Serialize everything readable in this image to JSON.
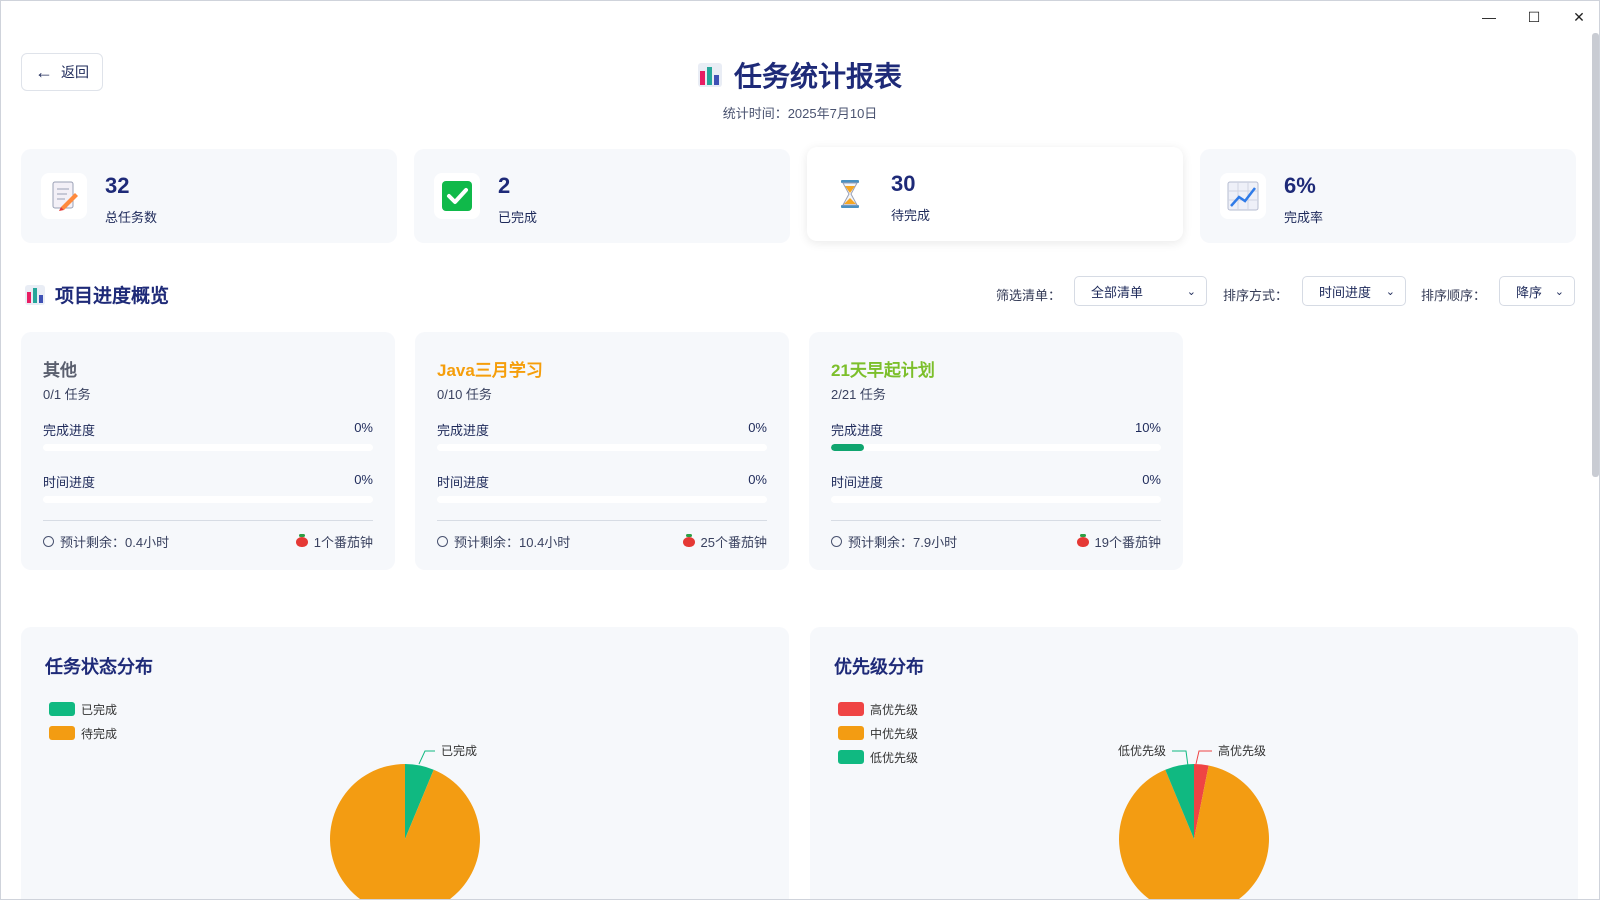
{
  "back_label": "返回",
  "header": {
    "title": "任务统计报表",
    "subtitle": "统计时间：2025年7月10日"
  },
  "stats": [
    {
      "value": "32",
      "label": "总任务数",
      "icon": "memo-icon"
    },
    {
      "value": "2",
      "label": "已完成",
      "icon": "check-icon"
    },
    {
      "value": "30",
      "label": "待完成",
      "icon": "hourglass-icon"
    },
    {
      "value": "6%",
      "label": "完成率",
      "icon": "trend-chart-icon"
    }
  ],
  "overview": {
    "title": "项目进度概览",
    "filter_label": "筛选清单：",
    "filter_value": "全部清单",
    "sort_label": "排序方式：",
    "sort_value": "时间进度",
    "order_label": "排序顺序：",
    "order_value": "降序"
  },
  "projects": [
    {
      "name": "其他",
      "color": "#5a5f6e",
      "count": "0/1 任务",
      "completion_label": "完成进度",
      "completion_pct": "0%",
      "completion": 0,
      "time_label": "时间进度",
      "time_pct": "0%",
      "time": 0,
      "remaining": "预计剩余：0.4小时",
      "pomodoro": "1个番茄钟"
    },
    {
      "name": "Java三月学习",
      "color": "#f59e0b",
      "count": "0/10 任务",
      "completion_label": "完成进度",
      "completion_pct": "0%",
      "completion": 0,
      "time_label": "时间进度",
      "time_pct": "0%",
      "time": 0,
      "remaining": "预计剩余：10.4小时",
      "pomodoro": "25个番茄钟"
    },
    {
      "name": "21天早起计划",
      "color": "#7cbf2b",
      "count": "2/21 任务",
      "completion_label": "完成进度",
      "completion_pct": "10%",
      "completion": 10,
      "time_label": "时间进度",
      "time_pct": "0%",
      "time": 0,
      "remaining": "预计剩余：7.9小时",
      "pomodoro": "19个番茄钟"
    }
  ],
  "charts": {
    "status": {
      "title": "任务状态分布",
      "legend": [
        {
          "label": "已完成",
          "color": "#10b981"
        },
        {
          "label": "待完成",
          "color": "#f39c12"
        }
      ],
      "slice_label": "已完成"
    },
    "priority": {
      "title": "优先级分布",
      "legend": [
        {
          "label": "高优先级",
          "color": "#ef4444"
        },
        {
          "label": "中优先级",
          "color": "#f39c12"
        },
        {
          "label": "低优先级",
          "color": "#10b981"
        }
      ],
      "slice_label_left": "低优先级",
      "slice_label_right": "高优先级"
    }
  },
  "chart_data": [
    {
      "type": "pie",
      "title": "任务状态分布",
      "categories": [
        "已完成",
        "待完成"
      ],
      "values": [
        2,
        30
      ],
      "legend": "top-left"
    },
    {
      "type": "pie",
      "title": "优先级分布",
      "categories": [
        "高优先级",
        "中优先级",
        "低优先级"
      ],
      "values": [
        1,
        29,
        2
      ],
      "legend": "top-left"
    }
  ]
}
